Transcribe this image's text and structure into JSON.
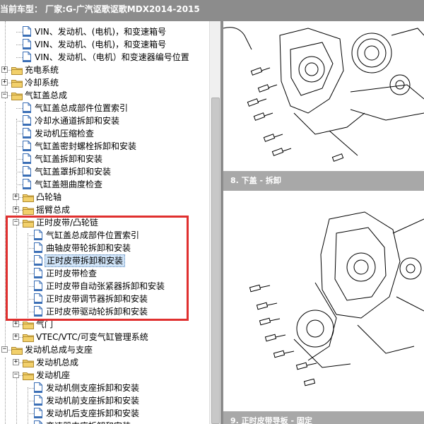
{
  "header": {
    "title": "当前车型：  厂家:G-广汽讴歌讴歌MDX2014-2015"
  },
  "tree": {
    "items": [
      {
        "label": "VIN、发动机、(电机)，和变速箱号",
        "type": "doc",
        "level": 1,
        "selected": false
      },
      {
        "label": "VIN、发动机、(电机)，和变速箱号",
        "type": "doc",
        "level": 1,
        "selected": false
      },
      {
        "label": "VIN、发动机、（电机）和变速器编号位置",
        "type": "doc",
        "level": 1,
        "selected": false
      },
      {
        "label": "充电系统",
        "type": "folder",
        "level": 0,
        "expander": "+",
        "selected": false
      },
      {
        "label": "冷却系统",
        "type": "folder",
        "level": 0,
        "expander": "+",
        "selected": false
      },
      {
        "label": "气缸盖总成",
        "type": "folder",
        "level": 0,
        "expander": "-",
        "selected": false
      },
      {
        "label": "气缸盖总成部件位置索引",
        "type": "doc",
        "level": 1,
        "selected": false
      },
      {
        "label": "冷却水通道拆卸和安装",
        "type": "doc",
        "level": 1,
        "selected": false
      },
      {
        "label": "发动机压缩检查",
        "type": "doc",
        "level": 1,
        "selected": false
      },
      {
        "label": "气缸盖密封螺栓拆卸和安装",
        "type": "doc",
        "level": 1,
        "selected": false
      },
      {
        "label": "气缸盖拆卸和安装",
        "type": "doc",
        "level": 1,
        "selected": false
      },
      {
        "label": "气缸盖罩拆卸和安装",
        "type": "doc",
        "level": 1,
        "selected": false
      },
      {
        "label": "气缸盖翘曲度检查",
        "type": "doc",
        "level": 1,
        "selected": false
      },
      {
        "label": "凸轮轴",
        "type": "folder",
        "level": 1,
        "expander": "+",
        "selected": false
      },
      {
        "label": "摇臂总成",
        "type": "folder",
        "level": 1,
        "expander": "+",
        "selected": false
      },
      {
        "label": "正时皮带/凸轮链",
        "type": "folder",
        "level": 1,
        "expander": "-",
        "selected": false
      },
      {
        "label": "气缸盖总成部件位置索引",
        "type": "doc",
        "level": 2,
        "selected": false
      },
      {
        "label": "曲轴皮带轮拆卸和安装",
        "type": "doc",
        "level": 2,
        "selected": false
      },
      {
        "label": "正时皮带拆卸和安装",
        "type": "doc",
        "level": 2,
        "selected": true
      },
      {
        "label": "正时皮带检查",
        "type": "doc",
        "level": 2,
        "selected": false
      },
      {
        "label": "正时皮带自动张紧器拆卸和安装",
        "type": "doc",
        "level": 2,
        "selected": false
      },
      {
        "label": "正时皮带调节器拆卸和安装",
        "type": "doc",
        "level": 2,
        "selected": false
      },
      {
        "label": "正时皮带驱动轮拆卸和安装",
        "type": "doc",
        "level": 2,
        "selected": false
      },
      {
        "label": "气门",
        "type": "folder",
        "level": 1,
        "expander": "+",
        "selected": false
      },
      {
        "label": "VTEC/VTC/可变气缸管理系统",
        "type": "folder",
        "level": 1,
        "expander": "+",
        "selected": false
      },
      {
        "label": "发动机总成与支座",
        "type": "folder",
        "level": 0,
        "expander": "-",
        "selected": false
      },
      {
        "label": "发动机总成",
        "type": "folder",
        "level": 1,
        "expander": "+",
        "selected": false
      },
      {
        "label": "发动机座",
        "type": "folder",
        "level": 1,
        "expander": "-",
        "selected": false
      },
      {
        "label": "发动机侧支座拆卸和安装",
        "type": "doc",
        "level": 2,
        "selected": false
      },
      {
        "label": "发动机前支座拆卸和安装",
        "type": "doc",
        "level": 2,
        "selected": false
      },
      {
        "label": "发动机后支座拆卸和安装",
        "type": "doc",
        "level": 2,
        "selected": false
      },
      {
        "label": "变速器支座拆卸和安装",
        "type": "doc",
        "level": 2,
        "selected": false
      }
    ]
  },
  "viewer": {
    "sections": [
      {
        "label": "8. 下盖 - 拆卸"
      },
      {
        "label": "9. 正时皮带导板 - 固定"
      }
    ]
  },
  "colors": {
    "header_bg": "#8c8c8c",
    "highlight_border": "#e0302f",
    "selection_bg": "#cfe3f7",
    "folder_yellow": "#f2d06b",
    "doc_blue": "#3b6fb6"
  },
  "icons": {
    "folder": "folder-icon",
    "document": "document-icon",
    "expand": "plus-icon",
    "collapse": "minus-icon"
  }
}
